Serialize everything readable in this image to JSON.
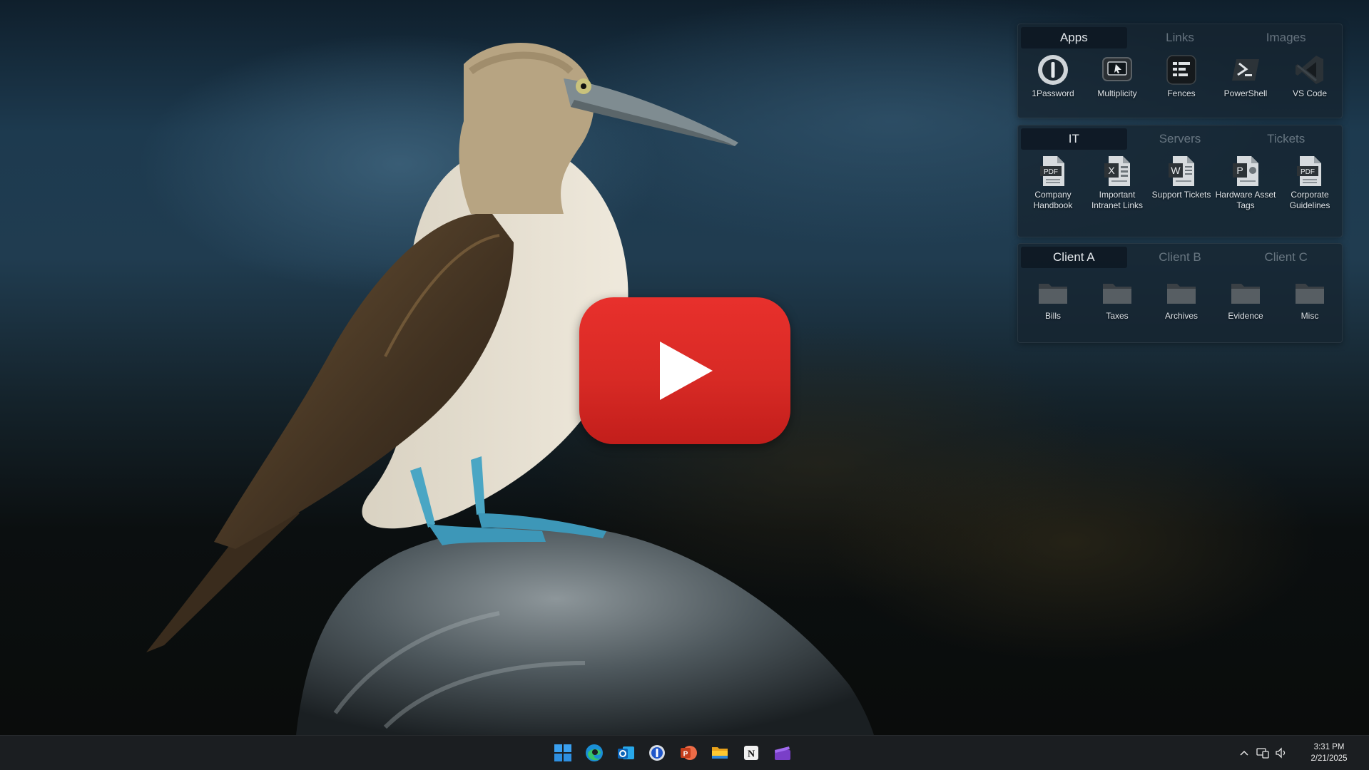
{
  "fences": [
    {
      "tabs": [
        "Apps",
        "Links",
        "Images"
      ],
      "items": [
        {
          "label": "1Password",
          "icon": "1password-icon"
        },
        {
          "label": "Multiplicity",
          "icon": "multiplicity-icon"
        },
        {
          "label": "Fences",
          "icon": "fences-icon"
        },
        {
          "label": "PowerShell",
          "icon": "powershell-icon"
        },
        {
          "label": "VS Code",
          "icon": "vscode-icon"
        }
      ]
    },
    {
      "tabs": [
        "IT",
        "Servers",
        "Tickets"
      ],
      "items": [
        {
          "label": "Company Handbook",
          "icon": "pdf-file-icon",
          "badge": "PDF"
        },
        {
          "label": "Important Intranet Links",
          "icon": "excel-file-icon",
          "badge": "X"
        },
        {
          "label": "Support Tickets",
          "icon": "word-file-icon",
          "badge": "W"
        },
        {
          "label": "Hardware Asset Tags",
          "icon": "powerpoint-file-icon",
          "badge": "P"
        },
        {
          "label": "Corporate Guidelines",
          "icon": "pdf-file-icon",
          "badge": "PDF"
        }
      ]
    },
    {
      "tabs": [
        "Client A",
        "Client B",
        "Client C"
      ],
      "items": [
        {
          "label": "Bills",
          "icon": "folder-icon"
        },
        {
          "label": "Taxes",
          "icon": "folder-icon"
        },
        {
          "label": "Archives",
          "icon": "folder-icon"
        },
        {
          "label": "Evidence",
          "icon": "folder-icon"
        },
        {
          "label": "Misc",
          "icon": "folder-icon"
        }
      ]
    }
  ],
  "taskbar": {
    "pinned": [
      "windows-start-icon",
      "edge-icon",
      "outlook-icon",
      "1password-icon",
      "powerpoint-icon",
      "file-explorer-icon",
      "notion-icon",
      "clapperboard-icon"
    ],
    "notion_letter": "N",
    "tray": [
      "chevron-up-icon",
      "network-icon",
      "volume-icon"
    ],
    "time": "3:31 PM",
    "date": "2/21/2025"
  },
  "video_overlay": {
    "icon": "play-button-icon",
    "color": "#e0302b"
  }
}
